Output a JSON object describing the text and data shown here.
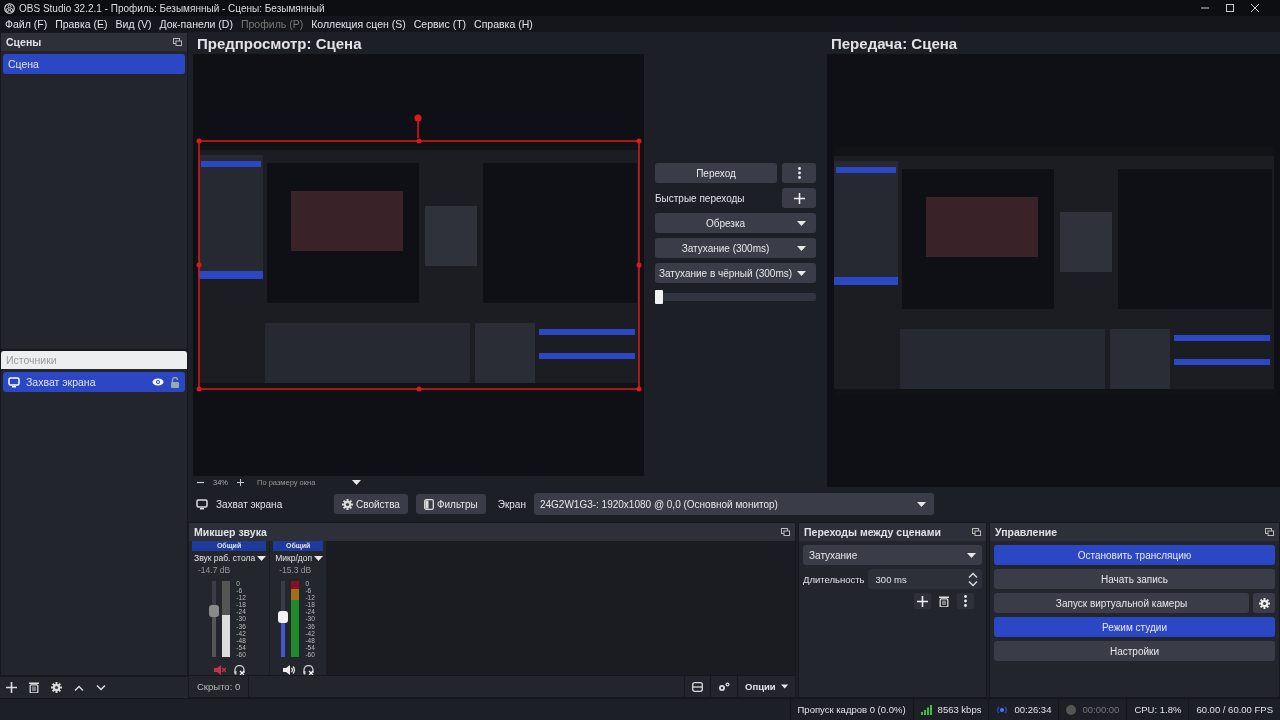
{
  "window": {
    "title": "OBS Studio 32.2.1 - Профиль: Безымянный - Сцены: Безымянный"
  },
  "menu": [
    {
      "label": "Файл (F)",
      "disabled": false
    },
    {
      "label": "Правка (E)",
      "disabled": false
    },
    {
      "label": "Вид (V)",
      "disabled": false
    },
    {
      "label": "Док-панели (D)",
      "disabled": false
    },
    {
      "label": "Профиль (P)",
      "disabled": true
    },
    {
      "label": "Коллекция сцен (S)",
      "disabled": false
    },
    {
      "label": "Сервис (T)",
      "disabled": false
    },
    {
      "label": "Справка (H)",
      "disabled": false
    }
  ],
  "scenes": {
    "title": "Сцены",
    "items": [
      {
        "label": "Сцена",
        "selected": true
      }
    ]
  },
  "sources": {
    "title": "Источники",
    "items": [
      {
        "label": "Захват экрана",
        "selected": true,
        "visible": true,
        "locked": false
      }
    ]
  },
  "preview": {
    "title": "Предпросмотр: Сцена",
    "zoom": "34%",
    "fit": "По размеру окна",
    "source_selected": true
  },
  "program": {
    "title": "Передача: Сцена"
  },
  "transition_panel": {
    "button": "Переход",
    "quick_label": "Быстрые переходы",
    "quick": [
      "Обрезка",
      "Затухание (300ms)",
      "Затухание в чёрный (300ms)"
    ],
    "tbar": {
      "level": 0
    }
  },
  "source_toolbar": {
    "source": "Захват экрана",
    "properties": "Свойства",
    "filters": "Фильтры",
    "display_label": "Экран",
    "display_value": "24G2W1G3-: 1920x1080 @ 0,0 (Основной монитор)"
  },
  "mixer": {
    "title": "Микшер звука",
    "hidden": "Скрыто: 0",
    "options": "Опции",
    "channels": [
      {
        "group": "Общий",
        "name": "Звук раб. стола",
        "reading": "-14.7 dB",
        "muted": true,
        "level": 0.6,
        "scale": [
          "0",
          "-6",
          "-12",
          "-18",
          "-24",
          "-30",
          "-36",
          "-42",
          "-48",
          "-54",
          "-60"
        ]
      },
      {
        "group": "Общий",
        "name": "Микр/доп",
        "reading": "-15.3 dB",
        "muted": false,
        "level": 0.52,
        "scale": [
          "0",
          "-6",
          "-12",
          "-18",
          "-24",
          "-30",
          "-36",
          "-42",
          "-48",
          "-54",
          "-60"
        ]
      }
    ]
  },
  "scene_transitions": {
    "title": "Переходы между сценами",
    "transition": "Затухание",
    "duration_label": "Длительность",
    "duration": "300 ms"
  },
  "controls": {
    "title": "Управление",
    "buttons": [
      {
        "label": "Остановить трансляцию",
        "active": true,
        "has_settings": false
      },
      {
        "label": "Начать запись",
        "active": false,
        "has_settings": false
      },
      {
        "label": "Запуск виртуальной камеры",
        "active": false,
        "has_settings": true
      },
      {
        "label": "Режим студии",
        "active": true,
        "has_settings": false
      },
      {
        "label": "Настройки",
        "active": false,
        "has_settings": false
      }
    ]
  },
  "status_bar": {
    "dropped": "Пропуск кадров 0 (0.0%)",
    "bitrate": "8563 kbps",
    "stream_time": "00:26:34",
    "streaming": true,
    "record_time": "00:00:00",
    "recording": false,
    "cpu": "CPU: 1.8%",
    "fps": "60.00 / 60.00 FPS"
  }
}
